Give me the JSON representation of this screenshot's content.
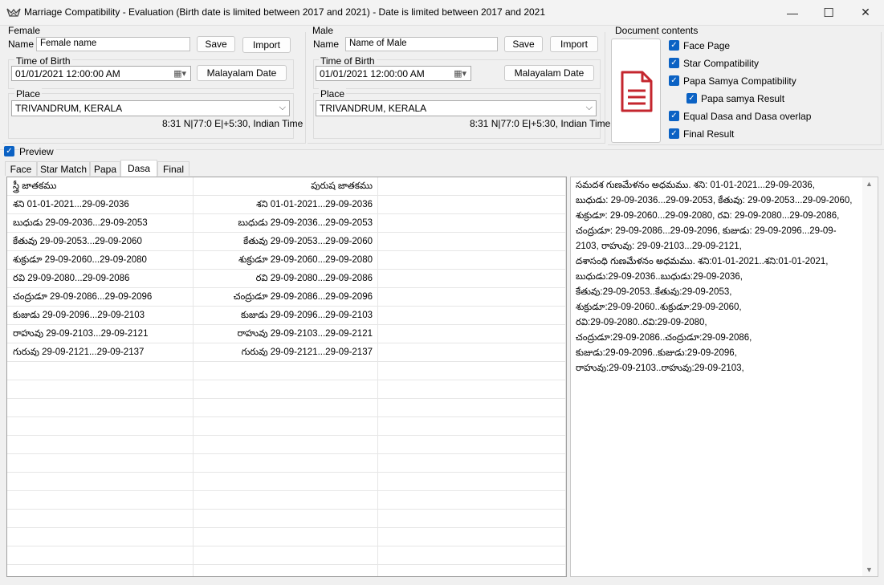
{
  "window": {
    "title": "Marriage  Compatibility - Evaluation  (Birth date is limited between 2017 and 2021)  - Date is limited between 2017 and 2021",
    "minimize": "—",
    "maximize": "☐",
    "close": "✕"
  },
  "female": {
    "group_label": "Female",
    "name_label": "Name",
    "name_value": "Female name",
    "save_label": "Save",
    "import_label": "Import",
    "tob_label": "Time of Birth",
    "tob_value": "01/01/2021  12:00:00 AM",
    "malayalam_label": "Malayalam Date",
    "place_label": "Place",
    "place_value": "TRIVANDRUM, KERALA",
    "coords": "8:31 N|77:0 E|+5:30, Indian Time"
  },
  "male": {
    "group_label": "Male",
    "name_label": "Name",
    "name_value": "Name of Male",
    "save_label": "Save",
    "import_label": "Import",
    "tob_label": "Time of Birth",
    "tob_value": "01/01/2021  12:00:00 AM",
    "malayalam_label": "Malayalam Date",
    "place_label": "Place",
    "place_value": "TRIVANDRUM, KERALA",
    "coords": "8:31 N|77:0 E|+5:30, Indian Time"
  },
  "doc_contents": {
    "label": "Document contents",
    "icon": "document-icon",
    "items": [
      {
        "label": "Face Page",
        "checked": true
      },
      {
        "label": "Star Compatibility",
        "checked": true
      },
      {
        "label": "Papa Samya Compatibility",
        "checked": true
      },
      {
        "label": "Papa samya Result",
        "checked": true
      },
      {
        "label": "Equal Dasa and Dasa overlap",
        "checked": true
      },
      {
        "label": "Final Result",
        "checked": true
      }
    ]
  },
  "preview": {
    "label": "Preview",
    "checked": true
  },
  "tabs": [
    {
      "label": "Face"
    },
    {
      "label": "Star Match"
    },
    {
      "label": "Papa"
    },
    {
      "label": "Dasa",
      "selected": true
    },
    {
      "label": "Final"
    }
  ],
  "grid": {
    "headers": [
      "స్త్రీ జాతకము",
      "పురుష జాతకము"
    ],
    "rows": [
      [
        "శని 01-01-2021...29-09-2036",
        "శని 01-01-2021...29-09-2036"
      ],
      [
        "బుధుడు 29-09-2036...29-09-2053",
        "బుధుడు 29-09-2036...29-09-2053"
      ],
      [
        "కేతువు 29-09-2053...29-09-2060",
        "కేతువు 29-09-2053...29-09-2060"
      ],
      [
        "శుక్రుడూ 29-09-2060...29-09-2080",
        "శుక్రుడూ 29-09-2060...29-09-2080"
      ],
      [
        "రవి 29-09-2080...29-09-2086",
        "రవి 29-09-2080...29-09-2086"
      ],
      [
        "చంద్రుడూ 29-09-2086...29-09-2096",
        "చంద్రుడూ 29-09-2086...29-09-2096"
      ],
      [
        "కుజుడు 29-09-2096...29-09-2103",
        "కుజుడు 29-09-2096...29-09-2103"
      ],
      [
        "రాహువు 29-09-2103...29-09-2121",
        "రాహువు 29-09-2103...29-09-2121"
      ],
      [
        "గురువు 29-09-2121...29-09-2137",
        "గురువు 29-09-2121...29-09-2137"
      ]
    ]
  },
  "text_panel": {
    "lines": [
      "సమదశ గుణమేళనం అధమము. శని: 01-01-2021...29-09-2036,",
      "బుధుడు: 29-09-2036...29-09-2053, కేతువు: 29-09-2053...29-09-2060,",
      "శుక్రుడూ: 29-09-2060...29-09-2080, రవి: 29-09-2080...29-09-2086,",
      "చంద్రుడూ: 29-09-2086...29-09-2096, కుజుడు: 29-09-2096...29-09-",
      "2103, రాహువు: 29-09-2103...29-09-2121,",
      "దశాసంధి గుణమేళనం అధమము. శని:01-01-2021..శని:01-01-2021,",
      "బుధుడు:29-09-2036..బుధుడు:29-09-2036,",
      "కేతువు:29-09-2053..కేతువు:29-09-2053,",
      "శుక్రుడూ:29-09-2060..శుక్రుడూ:29-09-2060,",
      "రవి:29-09-2080..రవి:29-09-2080,",
      "చంద్రుడూ:29-09-2086..చంద్రుడూ:29-09-2086,",
      "కుజుడు:29-09-2096..కుజుడు:29-09-2096,",
      "రాహువు:29-09-2103..రాహువు:29-09-2103,"
    ]
  },
  "icons": {
    "app": "app-logo-icon",
    "calendar": "calendar-icon",
    "dropdown": "chevron-down-icon",
    "scroll_up": "▲",
    "scroll_down": "▼",
    "check": "✓"
  },
  "colors": {
    "check_blue": "#0b62c4",
    "doc_red": "#c4262e"
  }
}
